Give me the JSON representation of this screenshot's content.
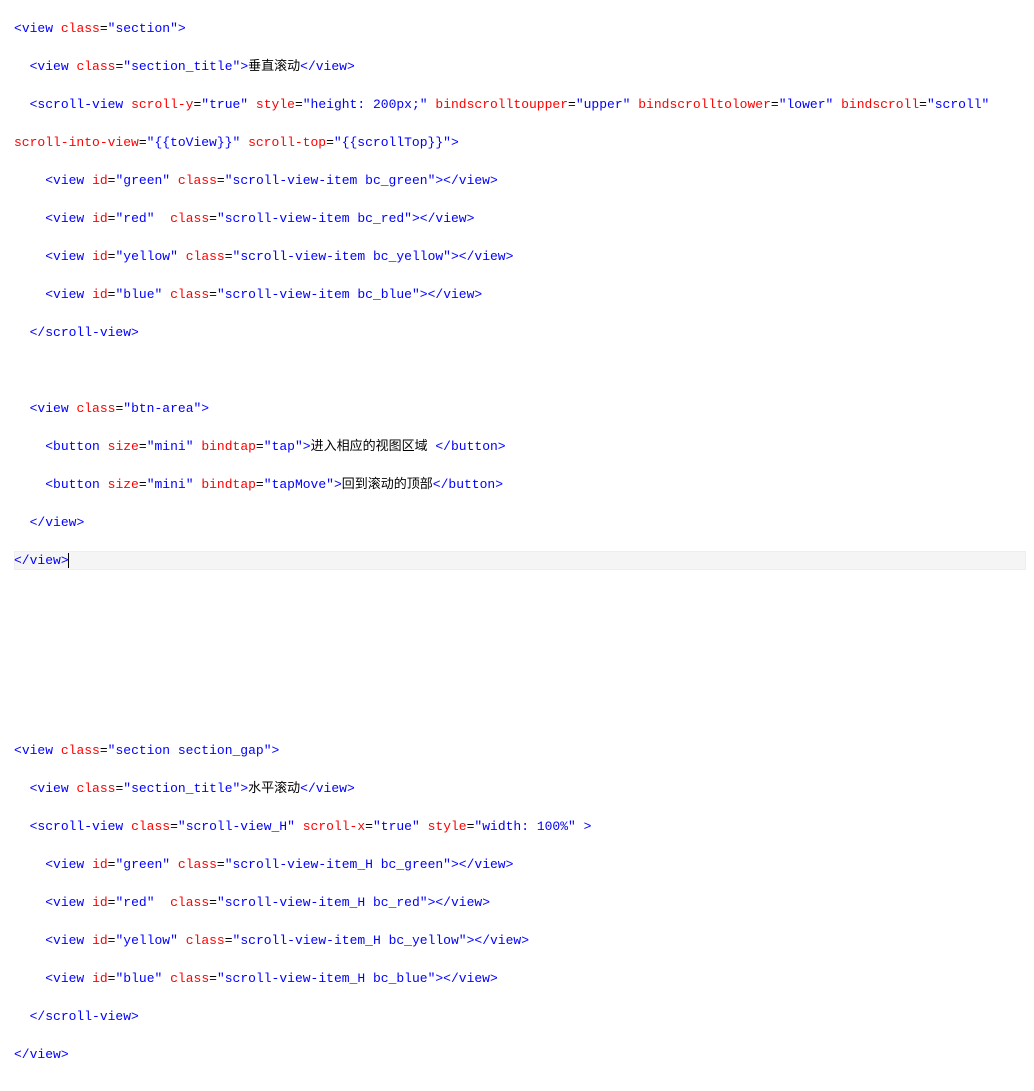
{
  "block1": {
    "l1": "<view class=\"section\">",
    "l2": "  <view class=\"section_title\">垂直滚动</view>",
    "l3": "  <scroll-view scroll-y=\"true\" style=\"height: 200px;\" bindscrolltoupper=\"upper\" bindscrolltolower=\"lower\" bindscroll=\"scroll\"",
    "l4": "scroll-into-view=\"{{toView}}\" scroll-top=\"{{scrollTop}}\">",
    "l5": "    <view id=\"green\" class=\"scroll-view-item bc_green\"></view>",
    "l6": "    <view id=\"red\"  class=\"scroll-view-item bc_red\"></view>",
    "l7": "    <view id=\"yellow\" class=\"scroll-view-item bc_yellow\"></view>",
    "l8": "    <view id=\"blue\" class=\"scroll-view-item bc_blue\"></view>",
    "l9": "  </scroll-view>",
    "l10": "",
    "l11": "  <view class=\"btn-area\">",
    "l12": "    <button size=\"mini\" bindtap=\"tap\">进入相应的视图区域 </button>",
    "l13": "    <button size=\"mini\" bindtap=\"tapMove\">回到滚动的顶部</button>",
    "l14": "  </view>",
    "l15": "</view>"
  },
  "block2": {
    "l1": "<view class=\"section section_gap\">",
    "l2": "  <view class=\"section_title\">水平滚动</view>",
    "l3": "  <scroll-view class=\"scroll-view_H\" scroll-x=\"true\" style=\"width: 100%\" >",
    "l4": "    <view id=\"green\" class=\"scroll-view-item_H bc_green\"></view>",
    "l5": "    <view id=\"red\"  class=\"scroll-view-item_H bc_red\"></view>",
    "l6": "    <view id=\"yellow\" class=\"scroll-view-item_H bc_yellow\"></view>",
    "l7": "    <view id=\"blue\" class=\"scroll-view-item_H bc_blue\"></view>",
    "l8": "  </scroll-view>",
    "l9": "</view>"
  },
  "colors": {
    "tag": "#0000ff",
    "attr": "#ff0000",
    "string": "#0000ff",
    "text": "#000000",
    "keywordstr": "#800000"
  }
}
